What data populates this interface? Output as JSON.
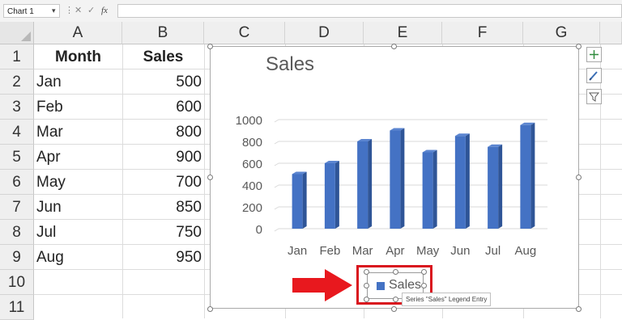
{
  "formula_bar": {
    "name_box": "Chart 1",
    "icons": [
      "more-icon",
      "cancel-icon",
      "enter-icon",
      "fx-icon"
    ],
    "fx_symbol": "fx",
    "formula": ""
  },
  "sheet": {
    "columns": [
      "A",
      "B",
      "C",
      "D",
      "E",
      "F",
      "G"
    ],
    "rows": [
      "1",
      "2",
      "3",
      "4",
      "5",
      "6",
      "7",
      "8",
      "9",
      "10",
      "11"
    ],
    "header_row": {
      "A": "Month",
      "B": "Sales"
    },
    "data": [
      {
        "month": "Jan",
        "sales": "500"
      },
      {
        "month": "Feb",
        "sales": "600"
      },
      {
        "month": "Mar",
        "sales": "800"
      },
      {
        "month": "Apr",
        "sales": "900"
      },
      {
        "month": "May",
        "sales": "700"
      },
      {
        "month": "Jun",
        "sales": "850"
      },
      {
        "month": "Jul",
        "sales": "750"
      },
      {
        "month": "Aug",
        "sales": "950"
      }
    ]
  },
  "chart_buttons": [
    "chart-elements-icon",
    "chart-styles-icon",
    "chart-filters-icon"
  ],
  "legend_tooltip": "Series \"Sales\" Legend Entry",
  "colors": {
    "bar": "#4472c4",
    "highlight": "#d9141e",
    "arrow": "#e8181e"
  },
  "chart_data": {
    "type": "bar",
    "style": "3d-column",
    "title": "Sales",
    "categories": [
      "Jan",
      "Feb",
      "Mar",
      "Apr",
      "May",
      "Jun",
      "Jul",
      "Aug"
    ],
    "series": [
      {
        "name": "Sales",
        "values": [
          500,
          600,
          800,
          900,
          700,
          850,
          750,
          950
        ]
      }
    ],
    "ylim": [
      0,
      1000
    ],
    "yticks": [
      "0",
      "200",
      "400",
      "600",
      "800",
      "1000"
    ],
    "grid": true,
    "legend": "bottom",
    "legend_selected": true
  }
}
